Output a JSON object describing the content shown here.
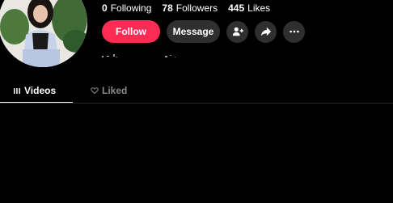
{
  "profile": {
    "stats": [
      {
        "value": "0",
        "label": "Following"
      },
      {
        "value": "78",
        "label": "Followers"
      },
      {
        "value": "445",
        "label": "Likes"
      }
    ]
  },
  "actions": {
    "follow_label": "Follow",
    "message_label": "Message",
    "icons": [
      "add-friend-icon",
      "share-icon",
      "more-icon"
    ]
  },
  "tabs": [
    {
      "label": "Videos",
      "icon": "grid-icon",
      "active": true
    },
    {
      "label": "Liked",
      "icon": "heart-lock-icon",
      "active": false
    }
  ],
  "colors": {
    "background": "#000000",
    "accent": "#fe2c55",
    "secondary_button": "#2f2f2f",
    "inactive_tab": "#8a8a8a"
  }
}
